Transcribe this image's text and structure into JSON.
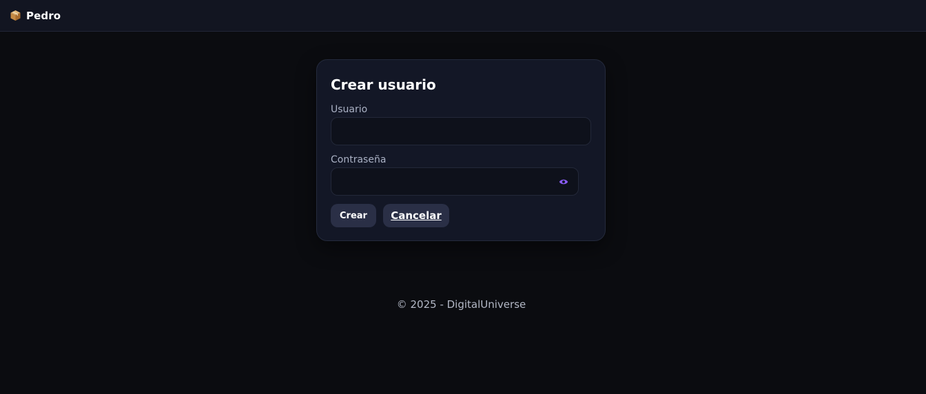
{
  "app": {
    "brand_name": "Pedro",
    "brand_icon": "package-icon"
  },
  "form": {
    "title": "Crear usuario",
    "username_label": "Usuario",
    "username_value": "",
    "password_label": "Contraseña",
    "password_value": "",
    "toggle_icon": "eye-icon",
    "create_label": "Crear",
    "cancel_label": "Cancelar"
  },
  "footer": {
    "text": "© 2025 - DigitalUniverse"
  },
  "colors": {
    "background": "#0b0c10",
    "topbar": "#121521",
    "card": "#131726",
    "button": "#2a2f46",
    "accent": "#8b5cf6"
  }
}
